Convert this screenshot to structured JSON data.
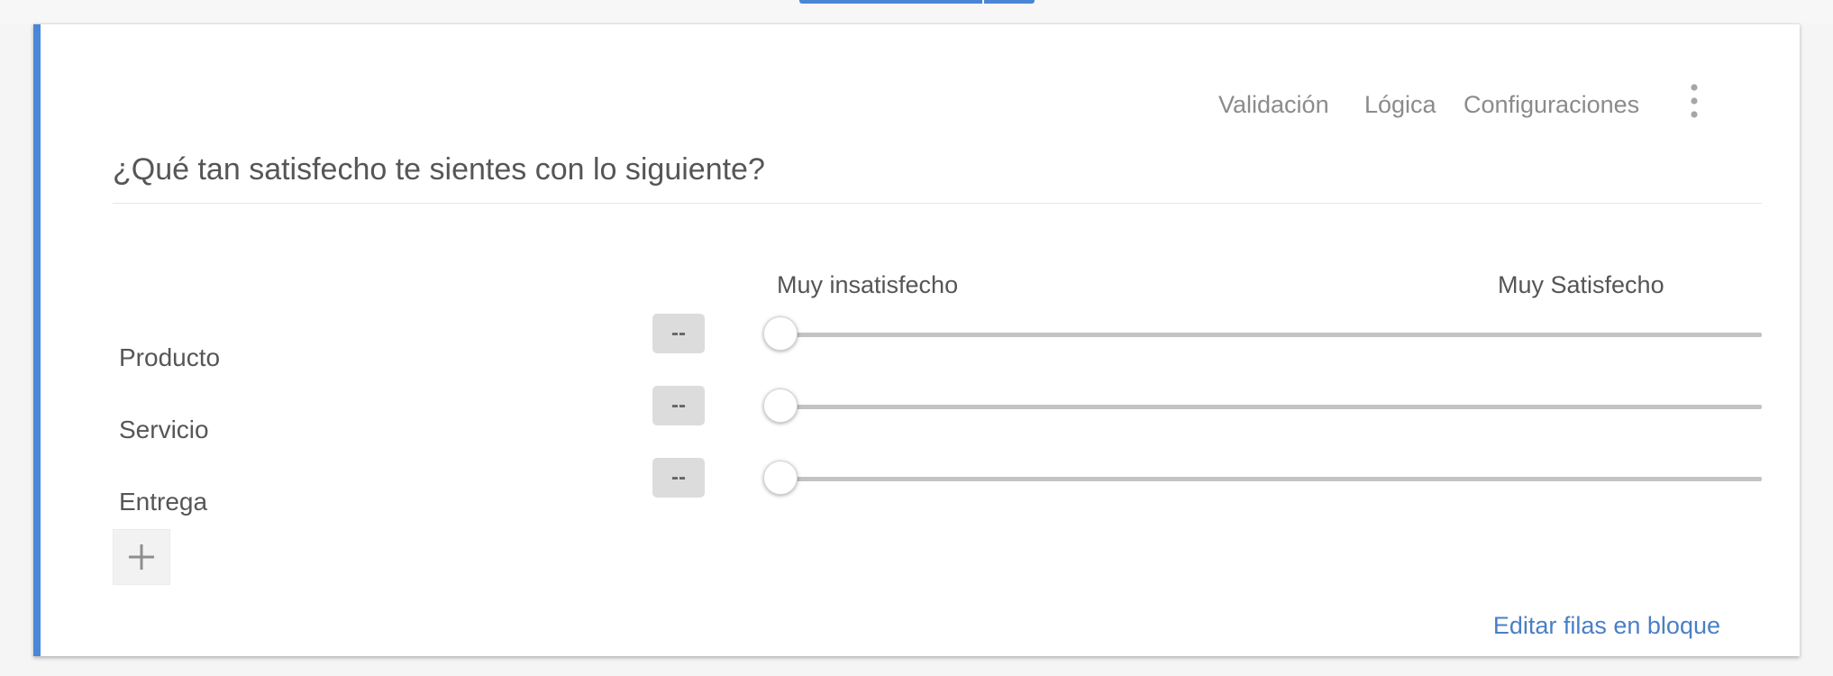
{
  "header": {
    "validation_label": "Validación",
    "logic_label": "Lógica",
    "settings_label": "Configuraciones"
  },
  "question": {
    "title": "¿Qué tan satisfecho te sientes con lo siguiente?",
    "scale_min_label": "Muy insatisfecho",
    "scale_max_label": "Muy Satisfecho",
    "rows": [
      {
        "label": "Producto",
        "value": "--",
        "slider_fraction": 0
      },
      {
        "label": "Servicio",
        "value": "--",
        "slider_fraction": 0
      },
      {
        "label": "Entrega",
        "value": "--",
        "slider_fraction": 0
      }
    ]
  },
  "footer": {
    "bulk_edit_label": "Editar filas en bloque"
  },
  "icons": {
    "more": "more-vertical-icon",
    "add": "plus-icon"
  },
  "colors": {
    "accent": "#4a86da",
    "link": "#4a7fc5",
    "track": "#c3c3c3"
  }
}
